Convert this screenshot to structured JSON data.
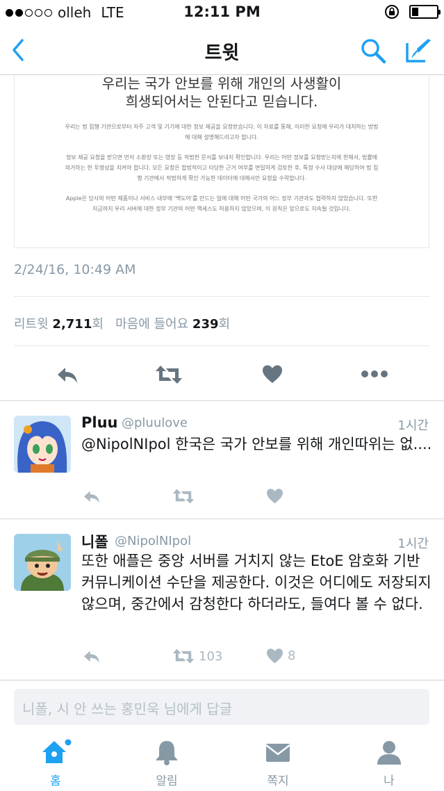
{
  "status_bar": {
    "carrier": "olleh",
    "network": "LTE",
    "time": "12:11 PM"
  },
  "nav": {
    "title": "트윗",
    "back_icon": "chevron-left-icon",
    "search_icon": "search-icon",
    "compose_icon": "compose-icon"
  },
  "embed": {
    "heading_line1": "우리는 국가 안보를 위해 개인의 사생활이",
    "heading_line2": "희생되어서는 안된다고 믿습니다.",
    "para1": "우리는 법 집행 기관으로부터 자주 고객 및 기기에 대한 정보 제공을 요청받습니다. 이 자료를 통해, 이러한 요청에 우리가 대처하는 방법에 대해 설명해드리고자 합니다.",
    "para2": "정보 제공 요청을 받으면 먼저 소환장 또는 영장 등 적법한 문서를 보내지 확인합니다. 우리는 어떤 정보를 요청받는지에 한해서, 법률에 의거하는 한 투명성을 지켜야 합니다. 모든 요청은 합법적이고 타당한 근거 여부를 면밀하게 검토한 후, 특정 수사 대상에 해당하여 법 집행 기관에서 적법하게 확인 가능한 데이터에 대해서만 요청을 수락합니다.",
    "para3": "Apple은 당사의 어떤 제품이나 서비스 내부에 '백도어'를 만드는 일에 대해 어떤 국가의 어느 정부 기관과도 협력하지 않았습니다. 또한 지금까지 우리 서버에 대한 정부 기관의 어떤 액세스도 허용하지 않았으며, 이 원칙은 앞으로도 지속될 것입니다."
  },
  "tweet_meta": {
    "timestamp": "2/24/16, 10:49 AM",
    "retweets_label": "리트윗",
    "retweets_count": "2,711",
    "likes_label": "마음에 들어요",
    "likes_count": "239",
    "count_suffix": "회"
  },
  "replies": [
    {
      "name": "Pluu",
      "handle": "@pluulove",
      "time": "1시간",
      "text": "@NipolNIpol 한국은 국가 안보를 위해 개인따위는 없....",
      "retweet_count": "",
      "like_count": ""
    },
    {
      "name": "니폴",
      "handle": "@NipolNIpol",
      "time": "1시간",
      "text": "또한 애플은 중앙 서버를 거치지 않는 EtoE 암호화 기반 커뮤니케이션 수단을 제공한다. 이것은 어디에도 저장되지 않으며, 중간에서 감청한다 하더라도, 들여다 볼 수 없다.",
      "retweet_count": "103",
      "like_count": "8"
    }
  ],
  "reply_box": {
    "placeholder": "니폴, 시 안 쓰는 홍민욱 님에게 답글"
  },
  "tabs": [
    {
      "label": "홈",
      "icon": "home-icon"
    },
    {
      "label": "알림",
      "icon": "bell-icon"
    },
    {
      "label": "쪽지",
      "icon": "mail-icon"
    },
    {
      "label": "나",
      "icon": "person-icon"
    }
  ],
  "colors": {
    "accent": "#1da1f2",
    "muted": "#8899a6",
    "icon_grey": "#667580",
    "divider": "#e1e8ed"
  }
}
